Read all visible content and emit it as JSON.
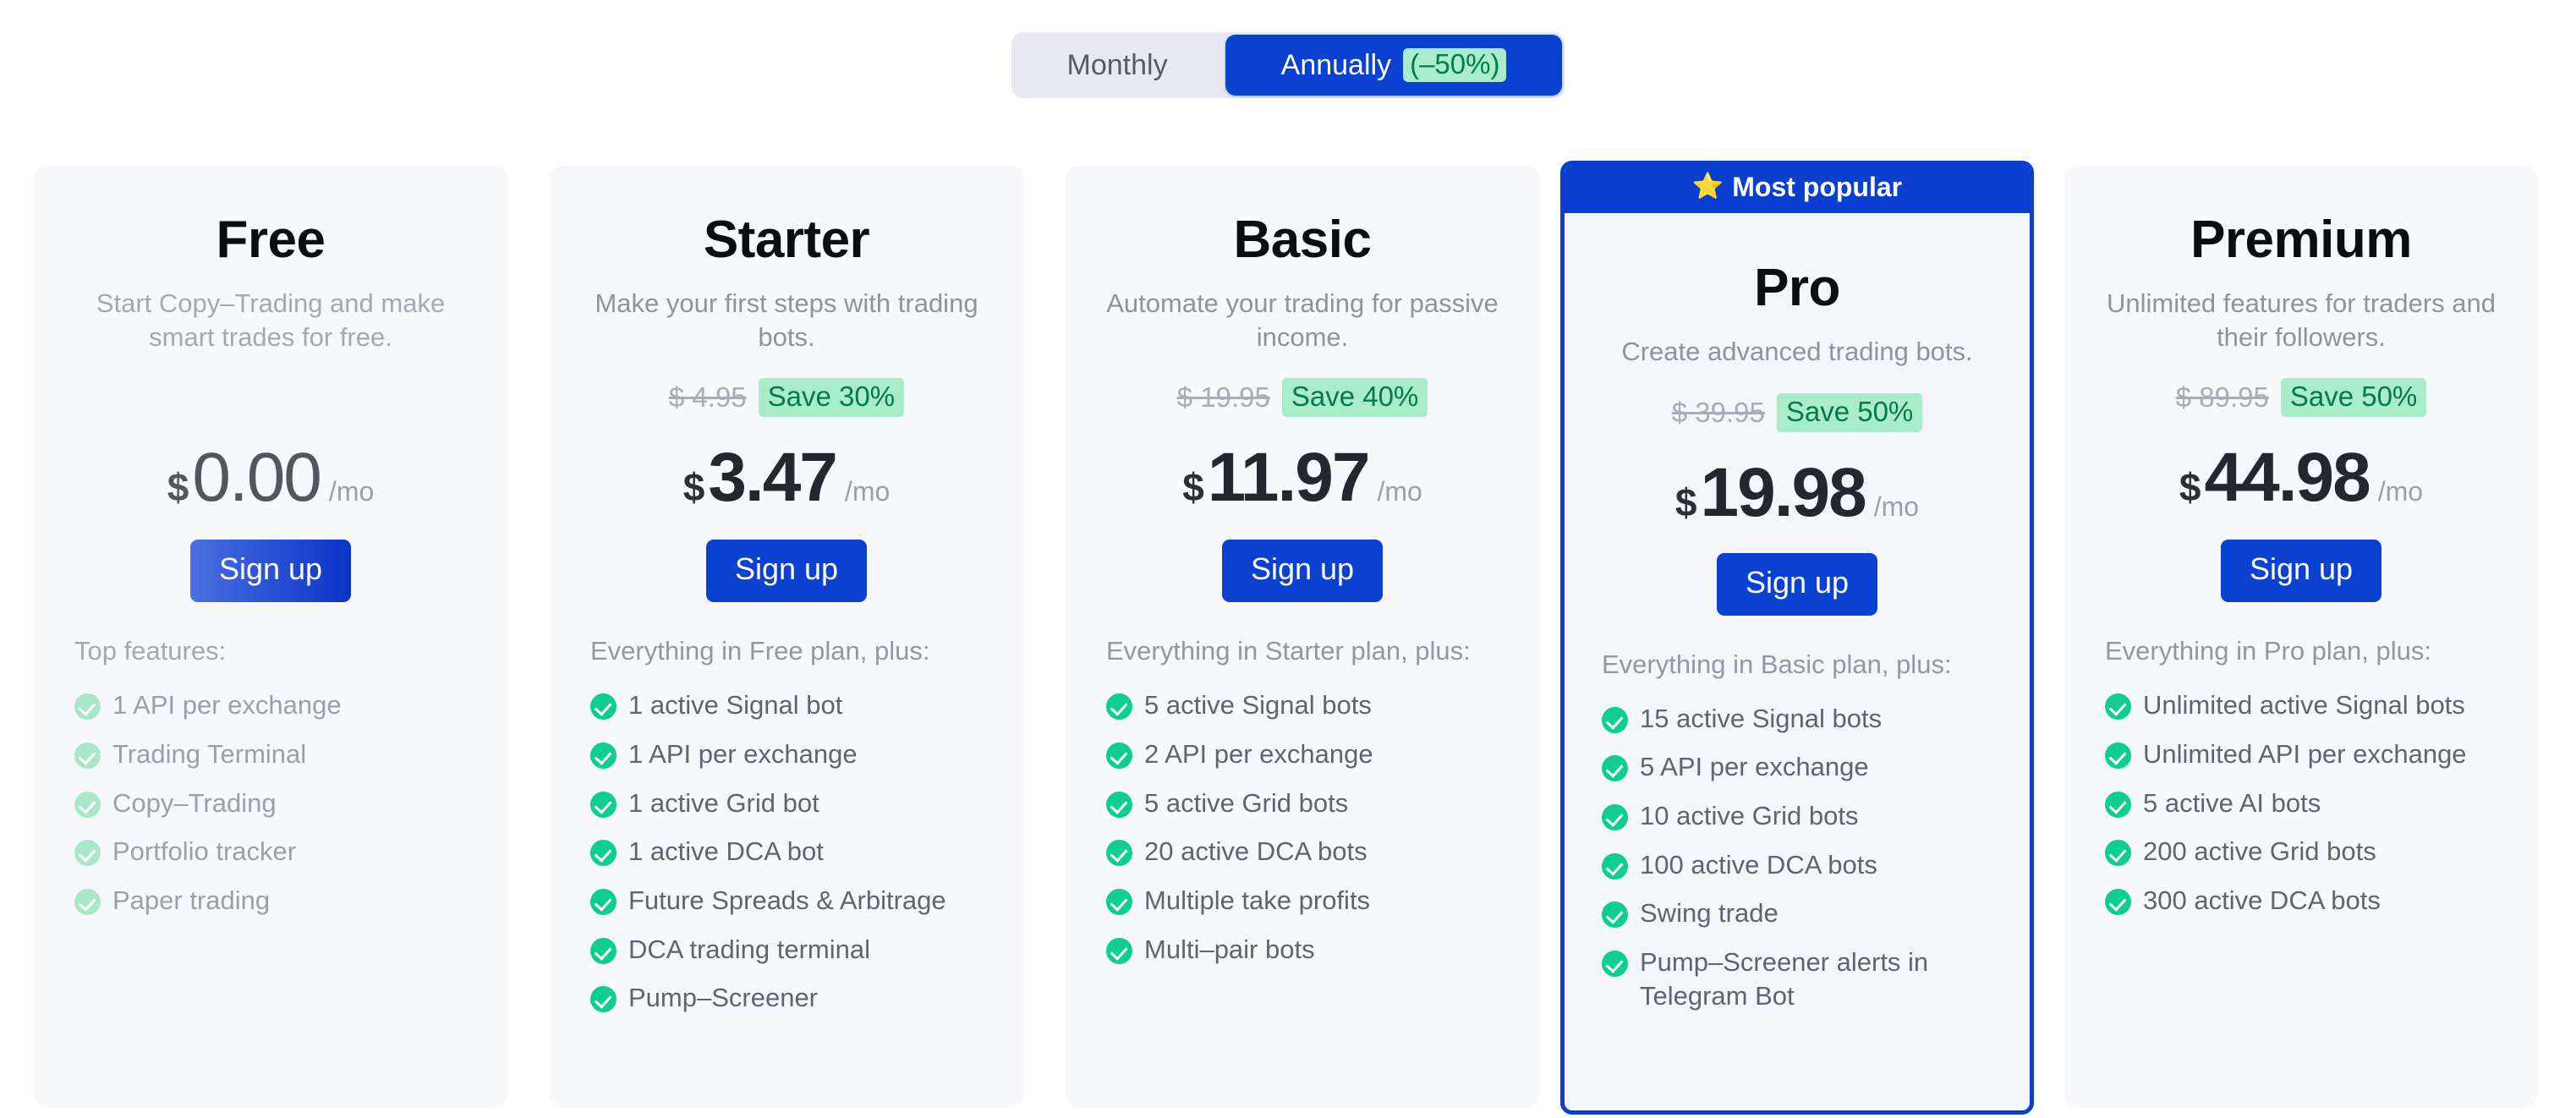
{
  "billing_toggle": {
    "monthly_label": "Monthly",
    "annually_label": "Annually",
    "annually_discount": "(–50%)",
    "active": "Annually"
  },
  "featured_banner": {
    "icon": "star-icon",
    "label": "Most popular"
  },
  "currency_symbol": "$",
  "period_suffix": "/mo",
  "signup_label": "Sign up",
  "plans": [
    {
      "name": "Free",
      "description": "Start Copy–Trading and make smart trades for free.",
      "old_price": "",
      "save_badge": "",
      "price": "0.00",
      "features_title": "Top features:",
      "features": [
        "1 API per exchange",
        "Trading Terminal",
        "Copy–Trading",
        "Portfolio tracker",
        "Paper trading"
      ]
    },
    {
      "name": "Starter",
      "description": "Make your first steps with trading bots.",
      "old_price": "$ 4.95",
      "save_badge": "Save 30%",
      "price": "3.47",
      "features_title": "Everything in Free plan, plus:",
      "features": [
        "1 active Signal bot",
        "1 API per exchange",
        "1 active Grid bot",
        "1 active DCA bot",
        "Future Spreads & Arbitrage",
        "DCA trading terminal",
        "Pump–Screener"
      ]
    },
    {
      "name": "Basic",
      "description": "Automate your trading for passive income.",
      "old_price": "$ 19.95",
      "save_badge": "Save 40%",
      "price": "11.97",
      "features_title": "Everything in Starter plan, plus:",
      "features": [
        "5 active Signal bots",
        "2 API per exchange",
        "5 active Grid bots",
        "20 active DCA bots",
        "Multiple take profits",
        "Multi–pair bots"
      ]
    },
    {
      "name": "Pro",
      "description": "Create advanced trading bots.",
      "old_price": "$ 39.95",
      "save_badge": "Save 50%",
      "price": "19.98",
      "features_title": "Everything in Basic plan, plus:",
      "features": [
        "15 active Signal bots",
        "5 API per exchange",
        "10 active Grid bots",
        "100 active DCA bots",
        "Swing trade",
        "Pump–Screener alerts in Telegram Bot"
      ]
    },
    {
      "name": "Premium",
      "description": "Unlimited features for traders and their followers.",
      "old_price": "$ 89.95",
      "save_badge": "Save 50%",
      "price": "44.98",
      "features_title": "Everything in Pro plan, plus:",
      "features": [
        "Unlimited active Signal bots",
        "Unlimited API per exchange",
        "5 active AI bots",
        "200 active Grid bots",
        "300 active DCA bots"
      ]
    }
  ],
  "colors": {
    "accent_blue": "#0a41d1",
    "featured_border": "#0a3ecf",
    "save_badge_bg": "#a8ecc9",
    "save_badge_text": "#07784d",
    "check_green": "#0ece8f",
    "card_bg": "#f7f8fb",
    "toggle_track": "#e8e8f1"
  }
}
